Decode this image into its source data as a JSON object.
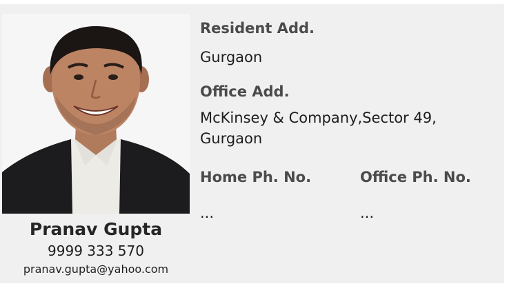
{
  "profile": {
    "name": "Pranav Gupta",
    "phone": "9999 333 570",
    "email": "pranav.gupta@yahoo.com"
  },
  "details": {
    "resident_label": "Resident Add.",
    "resident_value": "Gurgaon",
    "office_label": "Office Add.",
    "office_value_line1": "McKinsey & Company,Sector 49,",
    "office_value_line2": "Gurgaon",
    "home_phone_label": "Home Ph. No.",
    "home_phone_value": "...",
    "office_phone_label": "Office Ph. No.",
    "office_phone_value": "..."
  },
  "colors": {
    "card_bg": "#f0f0f0",
    "label": "#4b4b4b",
    "text": "#1e1e1e"
  }
}
